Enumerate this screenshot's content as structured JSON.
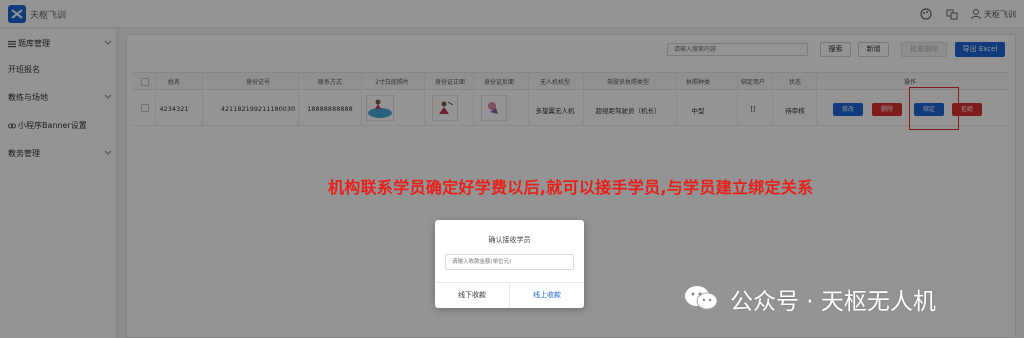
{
  "app": {
    "title": "天枢飞训"
  },
  "topbar": {
    "user_label": "天枢飞训"
  },
  "sidebar": {
    "items": [
      {
        "label": "题库管理",
        "has_children": true
      },
      {
        "label": "开班报名",
        "has_children": false
      },
      {
        "label": "教练与场地",
        "has_children": true
      },
      {
        "label": "小程序Banner设置",
        "has_children": false
      },
      {
        "label": "教务管理",
        "has_children": true
      }
    ]
  },
  "toolbar": {
    "search_placeholder": "请输入搜索内容",
    "search_label": "搜索",
    "add_label": "新增",
    "batch_delete_label": "批量删除",
    "export_label": "导出 Excel"
  },
  "table": {
    "columns": [
      "姓名",
      "身份证号",
      "联系方式",
      "2寸白底照片",
      "身份证正面",
      "身份证反面",
      "无人机机型",
      "驾驶员执照类型",
      "执照种类",
      "绑定用户",
      "状态",
      "操作"
    ],
    "rows": [
      {
        "name": "4234321",
        "id_number": "421182199211180030",
        "phone": "18888888888",
        "drone_type": "多旋翼无人机",
        "license_type": "超视距驾驶员（机长）",
        "license_class": "中型",
        "bound_user": "[]",
        "status": "待审核",
        "actions": {
          "edit": "修改",
          "delete": "删除",
          "bind": "绑定",
          "reject": "拒绝"
        }
      }
    ]
  },
  "annotation": "机构联系学员确定好学费以后,就可以接手学员,与学员建立绑定关系",
  "dialog": {
    "title": "确认接收学员",
    "input_placeholder": "请输入收款金额(单位元)",
    "offline_label": "线下收款",
    "online_label": "线上收款"
  },
  "watermark": {
    "text": "公众号 · 天枢无人机"
  },
  "colors": {
    "primary": "#1e66d6",
    "danger": "#d9302f",
    "annotation": "#e8201a"
  }
}
